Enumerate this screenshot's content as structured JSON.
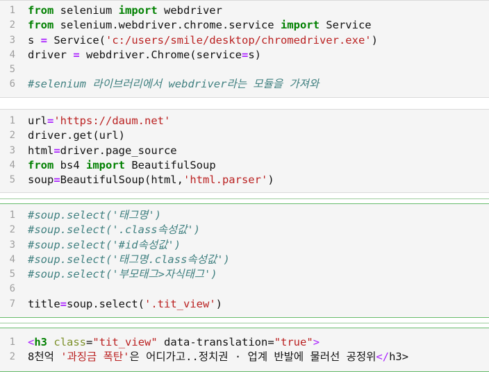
{
  "cells": [
    {
      "lines": [
        {
          "n": "1",
          "parts": [
            [
              "kw",
              "from"
            ],
            [
              "txt",
              " selenium "
            ],
            [
              "kw",
              "import"
            ],
            [
              "txt",
              " webdriver"
            ]
          ]
        },
        {
          "n": "2",
          "parts": [
            [
              "kw",
              "from"
            ],
            [
              "txt",
              " selenium.webdriver.chrome.service "
            ],
            [
              "kw",
              "import"
            ],
            [
              "txt",
              " Service"
            ]
          ]
        },
        {
          "n": "3",
          "parts": [
            [
              "txt",
              "s "
            ],
            [
              "op",
              "="
            ],
            [
              "txt",
              " Service("
            ],
            [
              "str",
              "'c:/users/smile/desktop/chromedriver.exe'"
            ],
            [
              "txt",
              ")"
            ]
          ]
        },
        {
          "n": "4",
          "parts": [
            [
              "txt",
              "driver "
            ],
            [
              "op",
              "="
            ],
            [
              "txt",
              " webdriver.Chrome(service"
            ],
            [
              "op",
              "="
            ],
            [
              "txt",
              "s)"
            ]
          ]
        },
        {
          "n": "5",
          "parts": []
        },
        {
          "n": "6",
          "parts": [
            [
              "cm",
              "#selenium 라이브러리에서 webdriver라는 모듈을 가져와"
            ]
          ]
        }
      ]
    },
    {
      "lines": [
        {
          "n": "1",
          "parts": [
            [
              "txt",
              "url"
            ],
            [
              "op",
              "="
            ],
            [
              "str",
              "'https://daum.net'"
            ]
          ]
        },
        {
          "n": "2",
          "parts": [
            [
              "txt",
              "driver.get(url)"
            ]
          ]
        },
        {
          "n": "3",
          "parts": [
            [
              "txt",
              "html"
            ],
            [
              "op",
              "="
            ],
            [
              "txt",
              "driver.page_source"
            ]
          ]
        },
        {
          "n": "4",
          "parts": [
            [
              "kw",
              "from"
            ],
            [
              "txt",
              " bs4 "
            ],
            [
              "kw",
              "import"
            ],
            [
              "txt",
              " BeautifulSoup"
            ]
          ]
        },
        {
          "n": "5",
          "parts": [
            [
              "txt",
              "soup"
            ],
            [
              "op",
              "="
            ],
            [
              "txt",
              "BeautifulSoup(html,"
            ],
            [
              "str",
              "'html.parser'"
            ],
            [
              "txt",
              ")"
            ]
          ]
        }
      ]
    },
    {
      "lines": [
        {
          "n": "1",
          "parts": [
            [
              "cm",
              "#soup.select('태그명')"
            ]
          ]
        },
        {
          "n": "2",
          "parts": [
            [
              "cm",
              "#soup.select('.class속성값')"
            ]
          ]
        },
        {
          "n": "3",
          "parts": [
            [
              "cm",
              "#soup.select('#id속성값')"
            ]
          ]
        },
        {
          "n": "4",
          "parts": [
            [
              "cm",
              "#soup.select('태그명.class속성값')"
            ]
          ]
        },
        {
          "n": "5",
          "parts": [
            [
              "cm",
              "#soup.select('부모태그>자식태그')"
            ]
          ]
        },
        {
          "n": "6",
          "parts": []
        },
        {
          "n": "7",
          "parts": [
            [
              "txt",
              "title"
            ],
            [
              "op",
              "="
            ],
            [
              "txt",
              "soup.select("
            ],
            [
              "str",
              "'.tit_view'"
            ],
            [
              "txt",
              ")"
            ]
          ]
        }
      ]
    },
    {
      "lines": [
        {
          "n": "1",
          "parts": [
            [
              "punct",
              "<"
            ],
            [
              "tag",
              "h3"
            ],
            [
              "txt",
              " "
            ],
            [
              "attr",
              "class"
            ],
            [
              "txt",
              "="
            ],
            [
              "str",
              "\"tit_view\""
            ],
            [
              "txt",
              " data-translation="
            ],
            [
              "str",
              "\"true\""
            ],
            [
              "punct",
              ">"
            ]
          ]
        },
        {
          "n": "2",
          "parts": [
            [
              "txt",
              "8천억 "
            ],
            [
              "str",
              "'과징금 폭탄'"
            ],
            [
              "txt",
              "은 어디가고..정치권 · 업계 반발에 물러선 공정위"
            ],
            [
              "punct",
              "</"
            ],
            [
              "txt",
              "h3>"
            ]
          ]
        }
      ]
    }
  ]
}
